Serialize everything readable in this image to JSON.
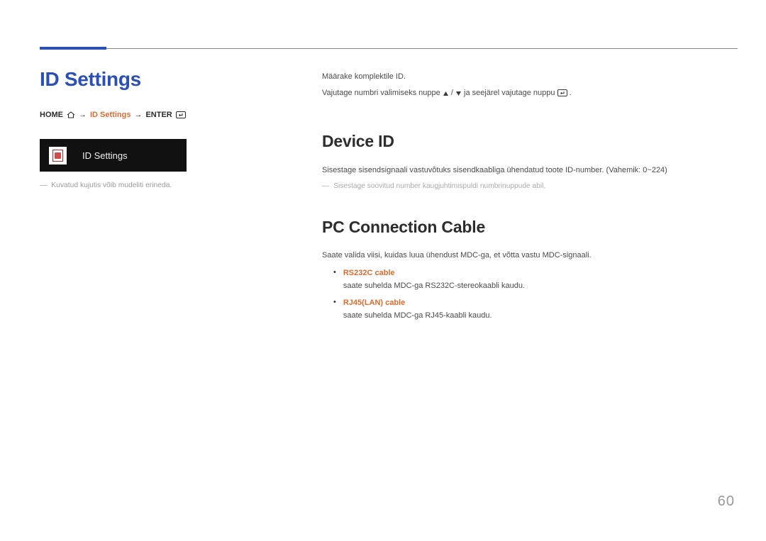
{
  "left": {
    "title": "ID Settings",
    "crumb_home": "HOME",
    "crumb_arrow": "→",
    "crumb_item": "ID Settings",
    "crumb_enter": "ENTER",
    "screenshot_label": "ID Settings",
    "note": "Kuvatud kujutis võib mudeliti erineda."
  },
  "right": {
    "intro1": "Määrake komplektile ID.",
    "intro2a": "Vajutage numbri valimiseks nuppe ",
    "intro2b": " ja seejärel vajutage nuppu ",
    "intro2c": ".",
    "h1": "Device ID",
    "p1": "Sisestage sisendsignaali vastuvõtuks sisendkaabliga ühendatud toote ID-number. (Vahemik: 0~224)",
    "p1_note": "Sisestage soovitud number kaugjuhtimispuldi numbrinuppude abil.",
    "h2": "PC Connection Cable",
    "p2": "Saate valida viisi, kuidas luua ühendust MDC-ga, et võtta vastu MDC-signaali.",
    "b1_title": "RS232C cable",
    "b1_text": "saate suhelda MDC-ga RS232C-stereokaabli kaudu.",
    "b2_title": "RJ45(LAN) cable",
    "b2_text": "saate suhelda MDC-ga RJ45-kaabli kaudu."
  },
  "page": "60"
}
